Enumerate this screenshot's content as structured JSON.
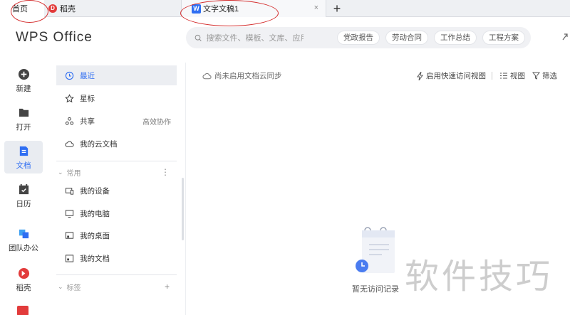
{
  "tabs": {
    "home_label": "首页",
    "daoke_label": "稻壳",
    "doc_label": "文字文稿1",
    "close_glyph": "×",
    "add_glyph": "+"
  },
  "header": {
    "logo": "WPS Office",
    "search_placeholder": "搜索文件、模板、文库、应用、技巧...",
    "chips": [
      "党政报告",
      "劳动合同",
      "工作总结",
      "工程方案"
    ]
  },
  "rail": {
    "items": [
      {
        "label": "新建",
        "icon": "plus-circle-icon"
      },
      {
        "label": "打开",
        "icon": "folder-icon"
      },
      {
        "label": "文档",
        "icon": "document-icon",
        "active": true
      },
      {
        "label": "日历",
        "icon": "calendar-icon"
      },
      {
        "label": "团队办公",
        "icon": "team-icon"
      },
      {
        "label": "稻壳",
        "icon": "daoke-icon"
      }
    ]
  },
  "nav": {
    "items": [
      {
        "label": "最近",
        "icon": "clock-icon",
        "active": true
      },
      {
        "label": "星标",
        "icon": "star-icon"
      },
      {
        "label": "共享",
        "icon": "share-icon",
        "right": "高效协作"
      },
      {
        "label": "我的云文档",
        "icon": "cloud-icon"
      }
    ],
    "common_section": "常用",
    "common_more": "⋮",
    "common_items": [
      {
        "label": "我的设备",
        "icon": "device-icon"
      },
      {
        "label": "我的电脑",
        "icon": "computer-icon"
      },
      {
        "label": "我的桌面",
        "icon": "desktop-icon"
      },
      {
        "label": "我的文档",
        "icon": "folder-doc-icon"
      }
    ],
    "tags_section": "标签",
    "tags_add": "+"
  },
  "main": {
    "cloud_note": "尚未启用文档云同步",
    "quick_view": "启用快速访问视图",
    "view": "视图",
    "filter": "筛选",
    "empty_text": "暂无访问记录"
  },
  "watermark": "软件技巧",
  "colors": {
    "accent": "#2f6ef2",
    "annotation": "#d42d2d",
    "daoke_red": "#e23b3b"
  }
}
